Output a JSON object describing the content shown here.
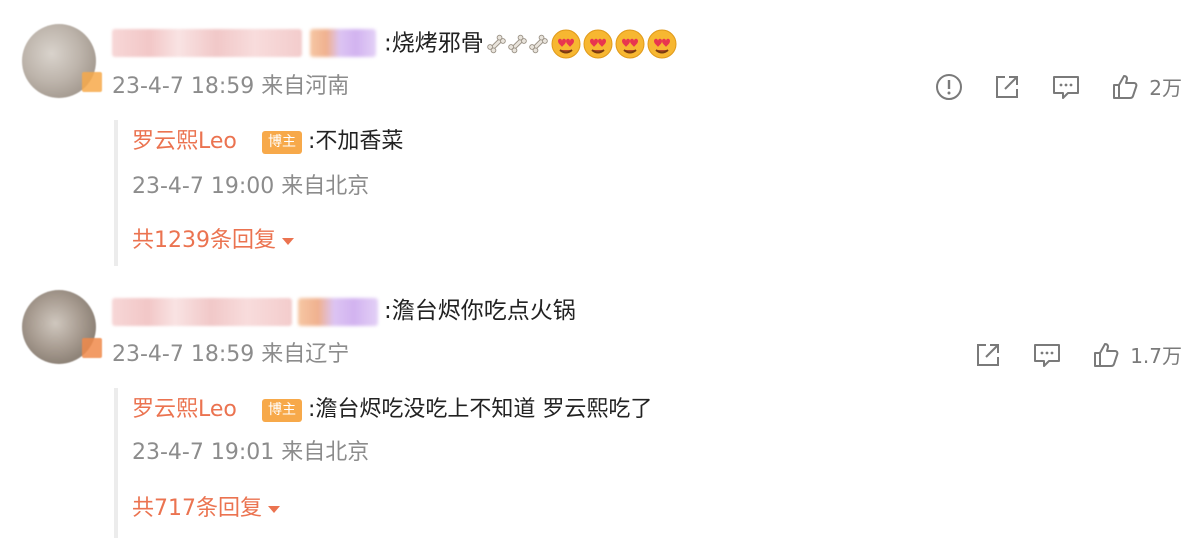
{
  "comments": [
    {
      "text_prefix": ":",
      "text": "烧烤邪骨",
      "emojis": [
        "bone-emoji",
        "bone-emoji",
        "bone-emoji",
        "heart-eyes-emoji",
        "heart-eyes-emoji",
        "heart-eyes-emoji",
        "heart-eyes-emoji"
      ],
      "time": "23-4-7 18:59 来自河南",
      "actions": {
        "like_count": "2万"
      },
      "reply": {
        "name": "罗云熙Leo",
        "tag": "博主",
        "text": ":不加香菜",
        "time": "23-4-7 19:00 来自北京",
        "more": "共1239条回复"
      }
    },
    {
      "text_prefix": ":",
      "text": "澹台烬你吃点火锅",
      "time": "23-4-7 18:59 来自辽宁",
      "actions": {
        "like_count": "1.7万"
      },
      "reply": {
        "name": "罗云熙Leo",
        "tag": "博主",
        "text": ":澹台烬吃没吃上不知道 罗云熙吃了",
        "time": "23-4-7 19:01 来自北京",
        "more": "共717条回复"
      }
    }
  ],
  "colors": {
    "accent": "#eb7350",
    "tag": "#f7a94a",
    "meta": "#8c8c8c"
  }
}
